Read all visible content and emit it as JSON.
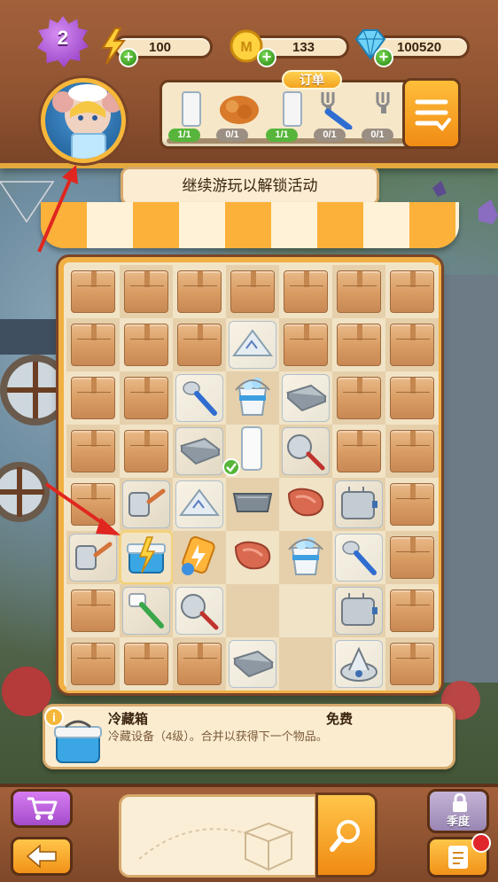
{
  "header": {
    "level": "2",
    "energy": "100",
    "coins": "133",
    "gems": "100520",
    "orders_tag": "订单",
    "orders": [
      {
        "item": "milk-glass",
        "count": "1/1",
        "state": "done"
      },
      {
        "item": "fried-food",
        "count": "0/1",
        "state": "todo"
      },
      {
        "item": "milk-glass",
        "count": "1/1",
        "state": "done"
      },
      {
        "item": "fork",
        "count": "0/1",
        "state": "todo"
      },
      {
        "item": "fork",
        "count": "0/1",
        "state": "todo"
      }
    ]
  },
  "banner": {
    "text": "继续游玩以解锁活动"
  },
  "board": {
    "rows": 8,
    "cols": 7,
    "cells": [
      [
        "box",
        "box",
        "box",
        "box",
        "box",
        "box",
        "box"
      ],
      [
        "box",
        "box",
        "box",
        "cone-filter-wrapped",
        "box",
        "box",
        "box"
      ],
      [
        "box",
        "box",
        "spoon-wrapped",
        "ice-bucket",
        "tray-wrapped",
        "box",
        "box"
      ],
      [
        "box",
        "box",
        "tray-wrapped",
        "milk-glass",
        "strainer-wrapped",
        "box",
        "box"
      ],
      [
        "box",
        "spatula-wrapped",
        "cone-filter-wrapped",
        "baking-pan",
        "steak",
        "toaster-wrapped",
        "box"
      ],
      [
        "spatula-wrapped",
        "cooler-selected",
        "energy-pack",
        "steak",
        "ice-bucket",
        "spoon-wrapped",
        "box"
      ],
      [
        "box",
        "brush-wrapped",
        "strainer-wrapped",
        "empty",
        "empty",
        "toaster-wrapped",
        "box"
      ],
      [
        "box",
        "box",
        "box",
        "tray-wrapped",
        "empty",
        "juicer-wrapped",
        "box"
      ]
    ]
  },
  "info": {
    "title": "冷藏箱",
    "price": "免费",
    "description": "冷藏设备（4级）。合并以获得下一个物品。"
  },
  "bottom": {
    "season_label": "季度"
  },
  "colors": {
    "wood": "#8f5331",
    "gold": "#f1b044",
    "accent_orange": "#f19218",
    "purple": "#a44ccc",
    "green": "#56b53a"
  }
}
